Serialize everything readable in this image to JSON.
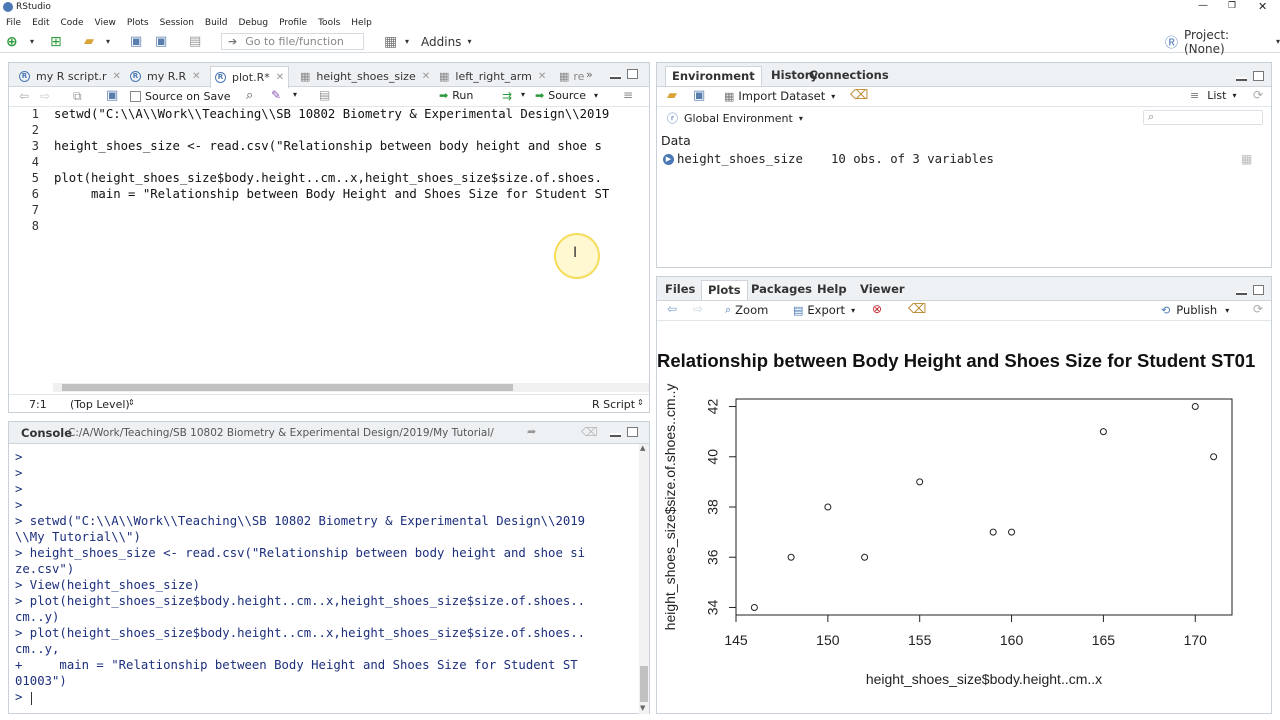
{
  "window": {
    "title": "RStudio"
  },
  "menu": [
    "File",
    "Edit",
    "Code",
    "View",
    "Plots",
    "Session",
    "Build",
    "Debug",
    "Profile",
    "Tools",
    "Help"
  ],
  "toolbar": {
    "goto_placeholder": "Go to file/function",
    "addins": "Addins",
    "project": "Project: (None)"
  },
  "editor": {
    "tabs": [
      "my R script.r",
      "my R.R",
      "plot.R*",
      "height_shoes_size",
      "left_right_arm",
      "re"
    ],
    "source_on_save": "Source on Save",
    "run": "Run",
    "source": "Source",
    "lines": [
      {
        "n": "1",
        "text": "setwd(\"C:\\\\A\\\\Work\\\\Teaching\\\\SB 10802 Biometry & Experimental Design\\\\2019"
      },
      {
        "n": "2",
        "text": ""
      },
      {
        "n": "3",
        "text": "height_shoes_size <- read.csv(\"Relationship between body height and shoe s"
      },
      {
        "n": "4",
        "text": ""
      },
      {
        "n": "5",
        "text": "plot(height_shoes_size$body.height..cm..x,height_shoes_size$size.of.shoes."
      },
      {
        "n": "6",
        "text": "     main = \"Relationship between Body Height and Shoes Size for Student ST"
      },
      {
        "n": "7",
        "text": ""
      },
      {
        "n": "8",
        "text": ""
      }
    ],
    "status_pos": "7:1",
    "status_scope": "(Top Level)",
    "status_type": "R Script"
  },
  "console": {
    "title": "Console",
    "path": "C:/A/Work/Teaching/SB 10802 Biometry & Experimental Design/2019/My Tutorial/",
    "lines": [
      ">",
      ">",
      ">",
      ">",
      "> setwd(\"C:\\\\A\\\\Work\\\\Teaching\\\\SB 10802 Biometry & Experimental Design\\\\2019",
      "\\\\My Tutorial\\\\\")",
      "> height_shoes_size <- read.csv(\"Relationship between body height and shoe si",
      "ze.csv\")",
      "> View(height_shoes_size)",
      "> plot(height_shoes_size$body.height..cm..x,height_shoes_size$size.of.shoes..",
      "cm..y)",
      "> plot(height_shoes_size$body.height..cm..x,height_shoes_size$size.of.shoes..",
      "cm..y,",
      "+     main = \"Relationship between Body Height and Shoes Size for Student ST",
      "01003\")",
      "> "
    ]
  },
  "environment": {
    "tabs": [
      "Environment",
      "History",
      "Connections"
    ],
    "import_dataset": "Import Dataset",
    "list": "List",
    "scope": "Global Environment",
    "section": "Data",
    "var_name": "height_shoes_size",
    "var_value": "10 obs. of 3 variables"
  },
  "plots_pane": {
    "tabs": [
      "Files",
      "Plots",
      "Packages",
      "Help",
      "Viewer"
    ],
    "zoom": "Zoom",
    "export": "Export",
    "publish": "Publish"
  },
  "chart_data": {
    "type": "scatter",
    "title": "Relationship between Body Height and Shoes Size for Student ST01",
    "xlabel": "height_shoes_size$body.height..cm..x",
    "ylabel": "height_shoes_size$size.of.shoes..cm..y",
    "x": [
      146,
      148,
      150,
      152,
      155,
      159,
      160,
      165,
      170,
      171
    ],
    "y": [
      34,
      36,
      38,
      36,
      39,
      37,
      37,
      41,
      42,
      40
    ],
    "xticks": [
      "145",
      "150",
      "155",
      "160",
      "165",
      "170"
    ],
    "yticks": [
      "34",
      "36",
      "38",
      "40",
      "42"
    ],
    "xlim": [
      145,
      172
    ],
    "ylim": [
      33.7,
      42.3
    ]
  }
}
